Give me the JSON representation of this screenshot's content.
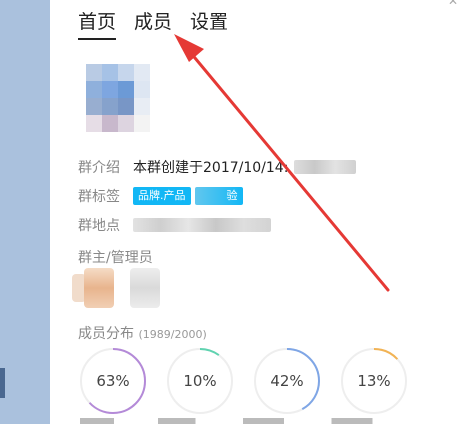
{
  "tabs": [
    {
      "label": "首页",
      "active": true
    },
    {
      "label": "成员",
      "active": false
    },
    {
      "label": "设置",
      "active": false
    }
  ],
  "group_info": {
    "intro_label": "群介绍",
    "intro_value": "本群创建于2017/10/14:",
    "tags_label": "群标签",
    "tags": [
      "品牌.产品",
      "验"
    ],
    "location_label": "群地点"
  },
  "admins_label": "群主/管理员",
  "members": {
    "label": "成员分布",
    "count": "(1989/2000)",
    "stats": [
      {
        "value": "63%",
        "fraction": 0.63,
        "color": "#b48ad8"
      },
      {
        "value": "10%",
        "fraction": 0.1,
        "color": "#5fd3b0"
      },
      {
        "value": "42%",
        "fraction": 0.42,
        "color": "#7fa6e6"
      },
      {
        "value": "13%",
        "fraction": 0.13,
        "color": "#f2b354"
      }
    ]
  },
  "colors": {
    "accent": "#12b7f5",
    "arrow": "#e53935",
    "sidebar": "#aac1dd"
  }
}
